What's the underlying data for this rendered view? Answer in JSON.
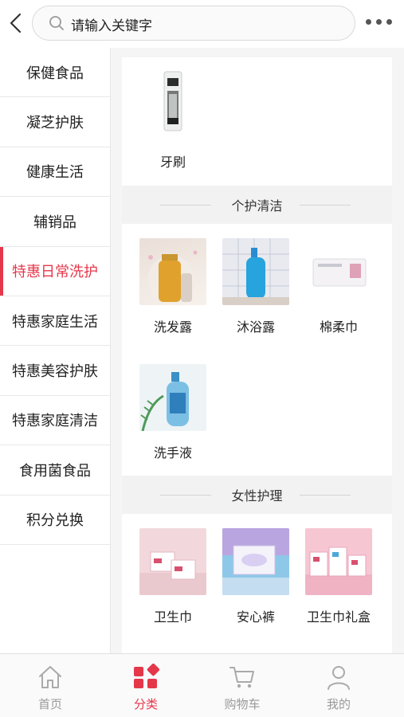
{
  "header": {
    "search_placeholder": "请输入关键字",
    "back_icon": "chevron-left-icon",
    "more_icon": "more-dots-icon"
  },
  "sidebar": {
    "items": [
      {
        "label": "保健食品"
      },
      {
        "label": "凝芝护肤"
      },
      {
        "label": "健康生活"
      },
      {
        "label": "辅销品"
      },
      {
        "label": "特惠日常洗护",
        "active": true
      },
      {
        "label": "特惠家庭生活"
      },
      {
        "label": "特惠美容护肤"
      },
      {
        "label": "特惠家庭清洁"
      },
      {
        "label": "食用菌食品"
      },
      {
        "label": "积分兑换"
      }
    ]
  },
  "content": {
    "top_products": [
      {
        "name": "牙刷"
      }
    ],
    "sections": [
      {
        "title": "个护清洁",
        "products": [
          {
            "name": "洗发露"
          },
          {
            "name": "沐浴露"
          },
          {
            "name": "棉柔巾"
          },
          {
            "name": "洗手液"
          }
        ]
      },
      {
        "title": "女性护理",
        "products": [
          {
            "name": "卫生巾"
          },
          {
            "name": "安心裤"
          },
          {
            "name": "卫生巾礼盒"
          }
        ]
      }
    ]
  },
  "tabbar": {
    "tabs": [
      {
        "label": "首页",
        "icon": "home-icon"
      },
      {
        "label": "分类",
        "icon": "category-icon",
        "active": true
      },
      {
        "label": "购物车",
        "icon": "cart-icon"
      },
      {
        "label": "我的",
        "icon": "user-icon"
      }
    ]
  },
  "colors": {
    "accent": "#e5374a"
  }
}
